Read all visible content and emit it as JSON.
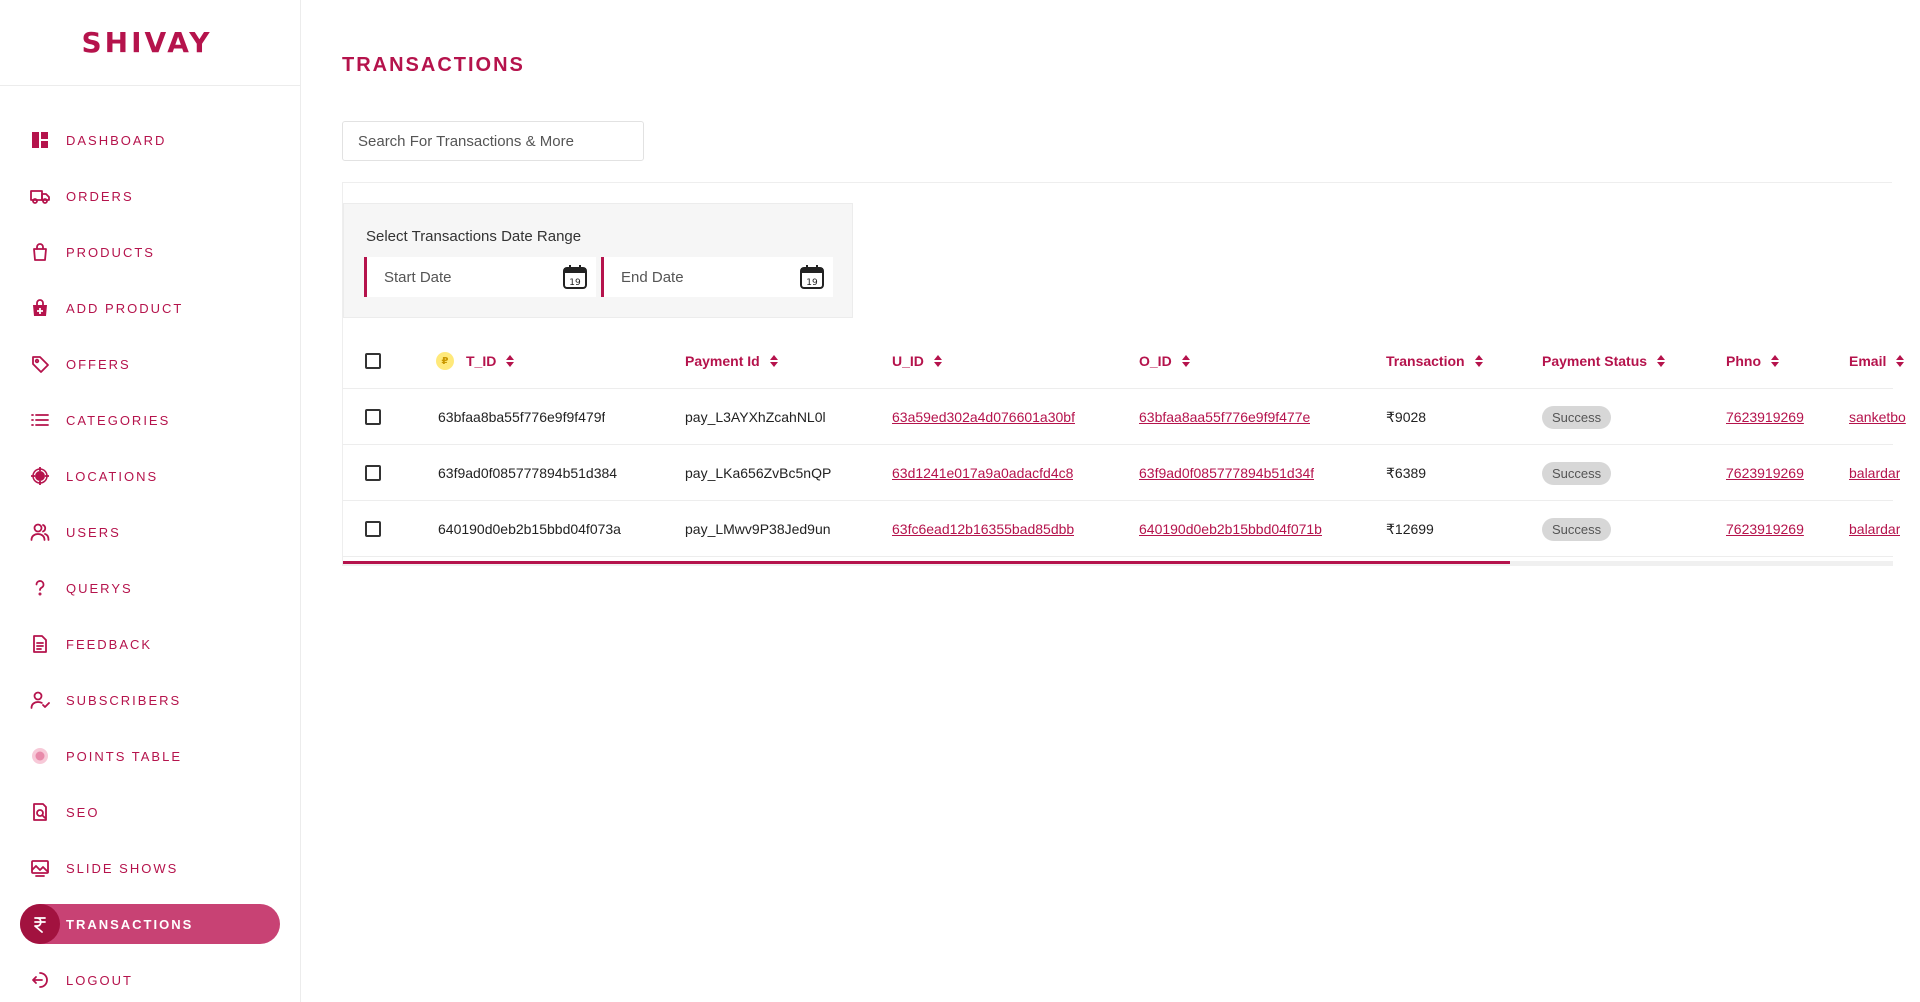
{
  "brand": {
    "logo_text": "SHIVAY",
    "accent": "#b5134c"
  },
  "sidebar": {
    "items": [
      {
        "label": "DASHBOARD",
        "icon": "dashboard-icon"
      },
      {
        "label": "ORDERS",
        "icon": "truck-icon"
      },
      {
        "label": "PRODUCTS",
        "icon": "shopping-bag-icon"
      },
      {
        "label": "ADD PRODUCT",
        "icon": "add-bag-icon"
      },
      {
        "label": "OFFERS",
        "icon": "tag-icon"
      },
      {
        "label": "CATEGORIES",
        "icon": "list-icon"
      },
      {
        "label": "LOCATIONS",
        "icon": "location-target-icon"
      },
      {
        "label": "USERS",
        "icon": "users-icon"
      },
      {
        "label": "QUERYS",
        "icon": "question-icon"
      },
      {
        "label": "FEEDBACK",
        "icon": "document-icon"
      },
      {
        "label": "SUBSCRIBERS",
        "icon": "user-check-icon"
      },
      {
        "label": "POINTS TABLE",
        "icon": "points-badge-icon"
      },
      {
        "label": "SEO",
        "icon": "seo-search-doc-icon"
      },
      {
        "label": "SLIDE SHOWS",
        "icon": "slideshow-icon"
      },
      {
        "label": "TRANSACTIONS",
        "icon": "rupee-icon",
        "active": true
      },
      {
        "label": "LOGOUT",
        "icon": "logout-icon"
      }
    ]
  },
  "main": {
    "title": "TRANSACTIONS",
    "search_placeholder": "Search For Transactions & More",
    "date_range": {
      "caption": "Select Transactions Date Range",
      "start_placeholder": "Start Date",
      "end_placeholder": "End Date",
      "calendar_day": "19"
    },
    "table": {
      "columns": [
        "T_ID",
        "Payment Id",
        "U_ID",
        "O_ID",
        "Transaction",
        "Payment Status",
        "Phno",
        "Email"
      ],
      "rows": [
        {
          "t_id": "63bfaa8ba55f776e9f9f479f",
          "payment_id": "pay_L3AYXhZcahNL0l",
          "u_id": "63a59ed302a4d076601a30bf",
          "o_id": "63bfaa8aa55f776e9f9f477e",
          "amount": "₹9028",
          "status": "Success",
          "phno": "7623919269",
          "email": "sanketbo"
        },
        {
          "t_id": "63f9ad0f085777894b51d384",
          "payment_id": "pay_LKa656ZvBc5nQP",
          "u_id": "63d1241e017a9a0adacfd4c8",
          "o_id": "63f9ad0f085777894b51d34f",
          "amount": "₹6389",
          "status": "Success",
          "phno": "7623919269",
          "email": "balardar"
        },
        {
          "t_id": "640190d0eb2b15bbd04f073a",
          "payment_id": "pay_LMwv9P38Jed9un",
          "u_id": "63fc6ead12b16355bad85dbb",
          "o_id": "640190d0eb2b15bbd04f071b",
          "amount": "₹12699",
          "status": "Success",
          "phno": "7623919269",
          "email": "balardar"
        }
      ]
    }
  }
}
